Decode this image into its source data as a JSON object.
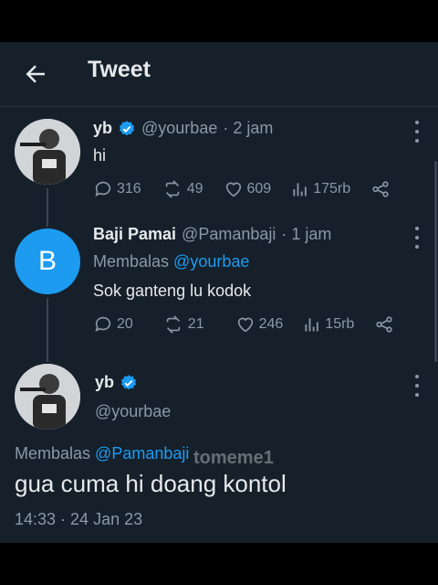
{
  "header": {
    "title": "Tweet"
  },
  "tweet1": {
    "name": "yb",
    "handle": "@yourbae",
    "time": "· 2 jam",
    "text": "hi",
    "replies": "316",
    "retweets": "49",
    "likes": "609",
    "views": "175rb"
  },
  "tweet2": {
    "avatar_letter": "B",
    "name": "Baji Pamai",
    "handle": "@Pamanbaji",
    "time": "· 1 jam",
    "reply_prefix": "Membalas",
    "reply_to": "@yourbae",
    "text": "Sok ganteng lu kodok",
    "replies": "20",
    "retweets": "21",
    "likes": "246",
    "views": "15rb"
  },
  "main": {
    "name": "yb",
    "handle": "@yourbae",
    "reply_prefix": "Membalas",
    "reply_to": "@Pamanbaji",
    "text": "gua cuma hi doang kontol",
    "timestamp": "14:33 · 24 Jan 23"
  },
  "watermark": "tomeme1",
  "colors": {
    "background": "#15202b",
    "accent": "#1d9bf0",
    "muted": "#8b98a5"
  }
}
